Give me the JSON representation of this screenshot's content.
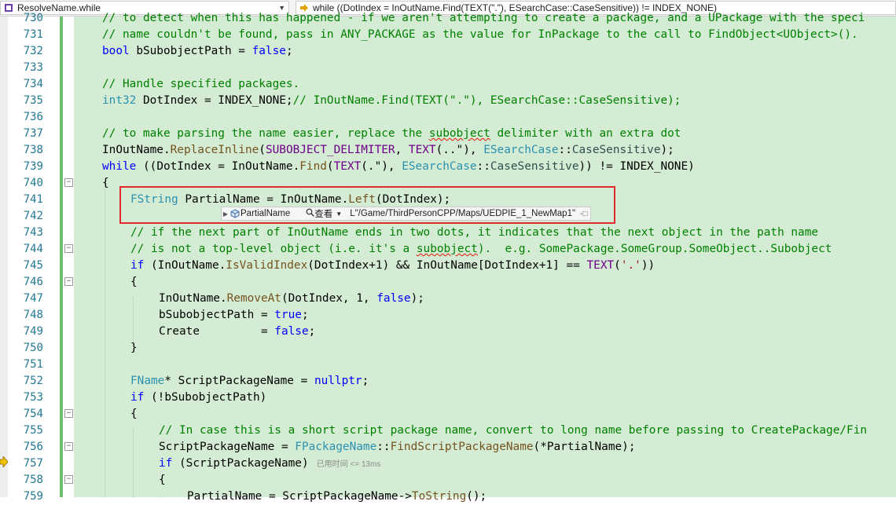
{
  "toolbar": {
    "scope_combo_value": "ResolveName.while",
    "statement_combo_value": "while ((DotIndex = InOutName.Find(TEXT(\".\"), ESearchCase::CaseSensitive)) != INDEX_NONE)"
  },
  "editor": {
    "lines": [
      {
        "n": "730",
        "text": "// to detect when this has happened - if we aren't attempting to create a package, and a UPackage with the speci"
      },
      {
        "n": "731",
        "text": "// name couldn't be found, pass in ANY_PACKAGE as the value for InPackage to the call to FindObject<UObject>()."
      },
      {
        "n": "732",
        "text": "bool bSubobjectPath = false;"
      },
      {
        "n": "733",
        "text": ""
      },
      {
        "n": "734",
        "text": "// Handle specified packages."
      },
      {
        "n": "735",
        "text": "int32 DotIndex = INDEX_NONE;// InOutName.Find(TEXT(\".\"), ESearchCase::CaseSensitive);"
      },
      {
        "n": "736",
        "text": ""
      },
      {
        "n": "737",
        "text": "// to make parsing the name easier, replace the subobject delimiter with an extra dot"
      },
      {
        "n": "738",
        "text": "InOutName.ReplaceInline(SUBOBJECT_DELIMITER, TEXT(\"..\"), ESearchCase::CaseSensitive);"
      },
      {
        "n": "739",
        "text": "while ((DotIndex = InOutName.Find(TEXT(\".\"), ESearchCase::CaseSensitive)) != INDEX_NONE)"
      },
      {
        "n": "740",
        "text": "{"
      },
      {
        "n": "741",
        "text": "FString PartialName = InOutName.Left(DotIndex);"
      },
      {
        "n": "742",
        "text": ""
      },
      {
        "n": "743",
        "text": "// if the next part of InOutName ends in two dots, it indicates that the next object in the path name"
      },
      {
        "n": "744",
        "text": "// is not a top-level object (i.e. it's a subobject).  e.g. SomePackage.SomeGroup.SomeObject..Subobject"
      },
      {
        "n": "745",
        "text": "if (InOutName.IsValidIndex(DotIndex+1) && InOutName[DotIndex+1] == TEXT('.'))"
      },
      {
        "n": "746",
        "text": "{"
      },
      {
        "n": "747",
        "text": "InOutName.RemoveAt(DotIndex, 1, false);"
      },
      {
        "n": "748",
        "text": "bSubobjectPath = true;"
      },
      {
        "n": "749",
        "text": "Create         = false;"
      },
      {
        "n": "750",
        "text": "}"
      },
      {
        "n": "751",
        "text": ""
      },
      {
        "n": "752",
        "text": "FName* ScriptPackageName = nullptr;"
      },
      {
        "n": "753",
        "text": "if (!bSubobjectPath)"
      },
      {
        "n": "754",
        "text": "{"
      },
      {
        "n": "755",
        "text": "// In case this is a short script package name, convert to long name before passing to CreatePackage/Fin"
      },
      {
        "n": "756",
        "text": "ScriptPackageName = FPackageName::FindScriptPackageName(*PartialName);"
      },
      {
        "n": "757",
        "text": "if (ScriptPackageName)"
      },
      {
        "n": "758",
        "text": "{"
      },
      {
        "n": "759",
        "text": "PartialName = ScriptPackageName->ToString();"
      }
    ],
    "elapsed_hint": "已用时间 <= 13ms"
  },
  "datatip": {
    "variable_name": "PartialName",
    "view_label": "查看",
    "value": "L\"/Game/ThirdPersonCPP/Maps/UEDPIE_1_NewMap1\""
  },
  "icons": {
    "scope_icon": "scope-icon",
    "statement_icon": "statement-icon",
    "object_icon": "object-icon",
    "magnifier_icon": "magnifier-icon",
    "pin_icon": "pin-icon",
    "instruction_pointer_icon": "instruction-pointer-icon"
  },
  "colors": {
    "code_background": "#d4ecd4",
    "highlight_border": "#e02a2a",
    "keyword": "#0000ff",
    "comment": "#008000"
  }
}
